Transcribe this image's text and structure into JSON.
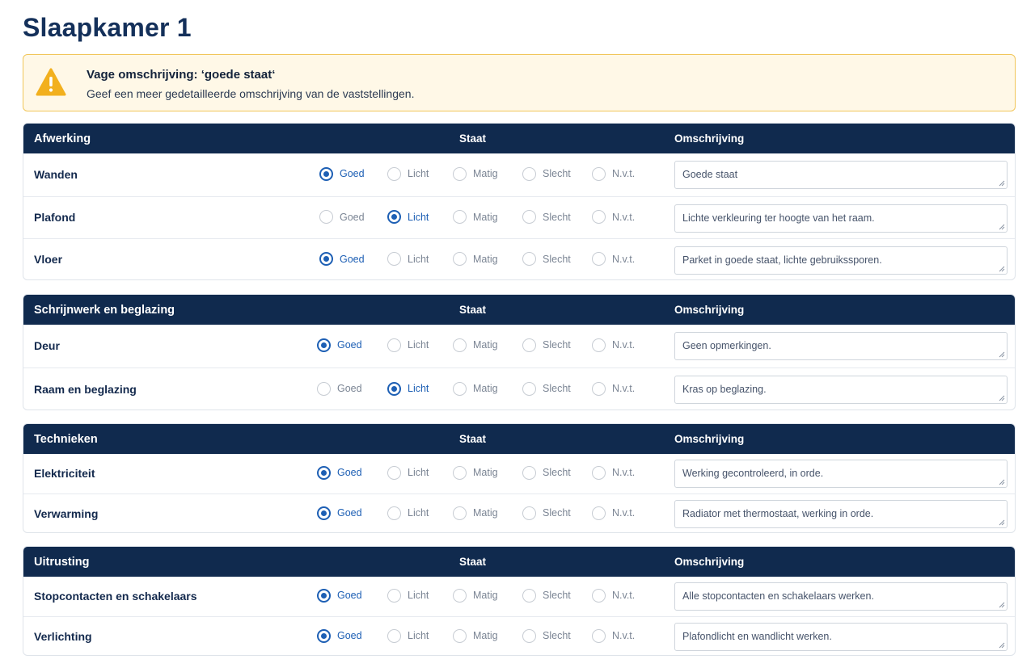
{
  "page_title": "Slaapkamer 1",
  "alert": {
    "icon": "warning-icon",
    "title": "Vage omschrijving: ‘goede staat‘",
    "text": "Geef een meer gedetailleerde omschrijving van de vaststellingen."
  },
  "column_headers": {
    "staat": "Staat",
    "omschrijving": "Omschrijving"
  },
  "options": [
    "Goed",
    "Licht",
    "Matig",
    "Slecht",
    "N.v.t."
  ],
  "colors": {
    "header_bg": "#102a4e",
    "accent": "#1d5fb4",
    "alert_bg": "#fff8e7",
    "alert_border": "#f1c65a",
    "warning": "#f2b01e"
  },
  "sections": [
    {
      "title": "Afwerking",
      "rows": [
        {
          "label": "Wanden",
          "selected": "Goed",
          "description": "Goede staat"
        },
        {
          "label": "Plafond",
          "selected": "Licht",
          "description": "Lichte verkleuring ter hoogte van het raam."
        },
        {
          "label": "Vloer",
          "selected": "Goed",
          "description": "Parket in goede staat, lichte gebruikssporen."
        }
      ]
    },
    {
      "title": "Schrijnwerk en beglazing",
      "rows": [
        {
          "label": "Deur",
          "selected": "Goed",
          "description": "Geen opmerkingen."
        },
        {
          "label": "Raam en beglazing",
          "selected": "Licht",
          "description": "Kras op beglazing."
        }
      ]
    },
    {
      "title": "Technieken",
      "rows": [
        {
          "label": "Elektriciteit",
          "selected": "Goed",
          "description": "Werking gecontroleerd, in orde."
        },
        {
          "label": "Verwarming",
          "selected": "Goed",
          "description": "Radiator met thermostaat, werking in orde."
        }
      ]
    },
    {
      "title": "Uitrusting",
      "rows": [
        {
          "label": "Stopcontacten en schakelaars",
          "selected": "Goed",
          "description": "Alle stopcontacten en schakelaars werken."
        },
        {
          "label": "Verlichting",
          "selected": "Goed",
          "description": "Plafondlicht en wandlicht werken."
        }
      ]
    }
  ]
}
